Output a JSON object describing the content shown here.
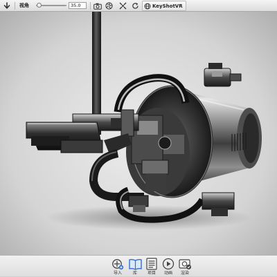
{
  "toolbar": {
    "fov_label": "视角",
    "fov_value": "35.0",
    "fov_slider_fraction": 0.1,
    "vr_label": "KeyShotVR",
    "icons": [
      "down-arrow-icon",
      "gear-icon",
      "fov-slider",
      "camera-icon",
      "aperture-icon",
      "crosshair-icon",
      "reset-icon",
      "vr-icon"
    ]
  },
  "bottom_bar": {
    "items": [
      {
        "label": "导入",
        "icon": "import-icon"
      },
      {
        "label": "库",
        "icon": "library-book-icon"
      },
      {
        "label": "项目",
        "icon": "project-list-icon"
      },
      {
        "label": "动画",
        "icon": "animation-play-icon"
      },
      {
        "label": "渲染",
        "icon": "render-icon"
      }
    ],
    "active_item": "库"
  },
  "colors": {
    "accent_blue": "#2f6fd0",
    "toolbar_bg": "#e6e6e6",
    "viewport_bg": "#d9d9d9"
  }
}
